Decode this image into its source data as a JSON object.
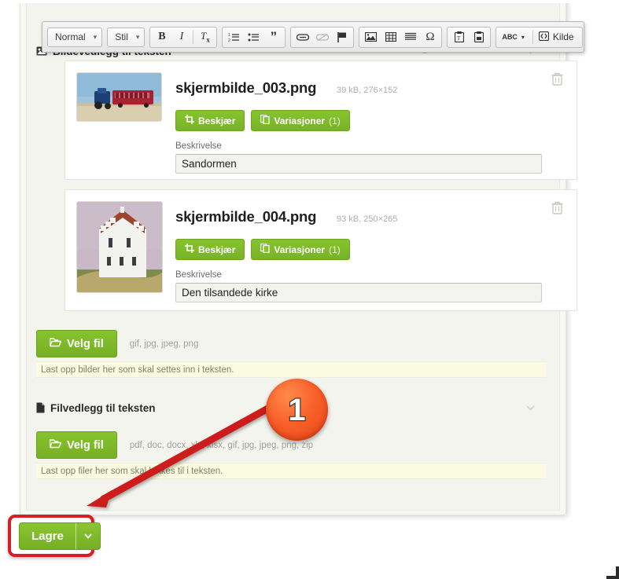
{
  "editor_toolbar": {
    "format_select": {
      "value": "Normal",
      "arrow": "▾"
    },
    "style_select": {
      "value": "Stil",
      "arrow": "▾"
    },
    "buttons": [
      {
        "name": "bold-button",
        "glyph": "B",
        "label": "Bold"
      },
      {
        "name": "italic-button",
        "glyph": "I",
        "label": "Italic"
      },
      {
        "name": "remove-format-button",
        "glyph": "Tx",
        "label": "Remove Format"
      },
      {
        "name": "numbered-list-button",
        "glyph": "list-ol",
        "label": "Numbered List"
      },
      {
        "name": "bulleted-list-button",
        "glyph": "list-ul",
        "label": "Bulleted List"
      },
      {
        "name": "blockquote-button",
        "glyph": "”",
        "label": "Block Quote"
      },
      {
        "name": "link-button",
        "glyph": "link",
        "label": "Link"
      },
      {
        "name": "unlink-button",
        "glyph": "unlink",
        "label": "Unlink"
      },
      {
        "name": "anchor-flag-button",
        "glyph": "flag",
        "label": "Anchor"
      },
      {
        "name": "image-button",
        "glyph": "image",
        "label": "Image"
      },
      {
        "name": "table-button",
        "glyph": "table",
        "label": "Table"
      },
      {
        "name": "horizontal-rule-button",
        "glyph": "hr",
        "label": "Horizontal Line"
      },
      {
        "name": "special-char-button",
        "glyph": "Ω",
        "label": "Special Character"
      },
      {
        "name": "paste-text-button",
        "glyph": "paste-text",
        "label": "Paste as plain text"
      },
      {
        "name": "paste-word-button",
        "glyph": "paste-word",
        "label": "Paste from Word"
      },
      {
        "name": "spellcheck-button",
        "glyph": "ABC",
        "label": "Spell Check"
      }
    ],
    "source_button": {
      "label": "Kilde"
    }
  },
  "image_section": {
    "title": "Bildevedlegg til teksten",
    "icon": "image-icon",
    "collapse_icon": "chevron-down-icon",
    "attachments": [
      {
        "filename": "skjermbilde_003.png",
        "meta": "39 kB, 276×152",
        "thumb_alt": "tractor-bus-beach-thumbnail",
        "crop_label": "Beskjær",
        "variants_label": "Variasjoner",
        "variants_count": "(1)",
        "description_label": "Beskrivelse",
        "description_value": "Sandormen",
        "delete_icon": "trash-icon"
      },
      {
        "filename": "skjermbilde_004.png",
        "meta": "93 kB, 250×265",
        "thumb_alt": "white-church-dune-thumbnail",
        "crop_label": "Beskjær",
        "variants_label": "Variasjoner",
        "variants_count": "(1)",
        "description_label": "Beskrivelse",
        "description_value": "Den tilsandede kirke",
        "delete_icon": "trash-icon"
      }
    ],
    "upload": {
      "button_label": "Velg fil",
      "button_icon": "folder-open-icon",
      "filetypes": "gif, jpg, jpeg, png",
      "hint": "Last opp bilder her som skal settes inn i teksten."
    }
  },
  "file_section": {
    "title": "Filvedlegg til teksten",
    "icon": "file-icon",
    "collapse_icon": "chevron-down-icon",
    "upload": {
      "button_label": "Velg fil",
      "button_icon": "folder-open-icon",
      "filetypes": "pdf, doc, docx, xls, xlsx, gif, jpg, jpeg, png, zip",
      "hint": "Last opp filer her som skal lenkes til i teksten."
    }
  },
  "footer": {
    "save_label": "Lagre",
    "save_caret_icon": "chevron-down-icon"
  },
  "annotation": {
    "step_number": "1",
    "arrow": "red-arrow-pointing-to-save",
    "highlight": "red-ring-around-save-button"
  },
  "colors": {
    "green": "#7cb82f",
    "red_highlight": "#d81f1f",
    "badge_orange": "#f8612a",
    "hint_yellow": "#fbfbe2"
  }
}
